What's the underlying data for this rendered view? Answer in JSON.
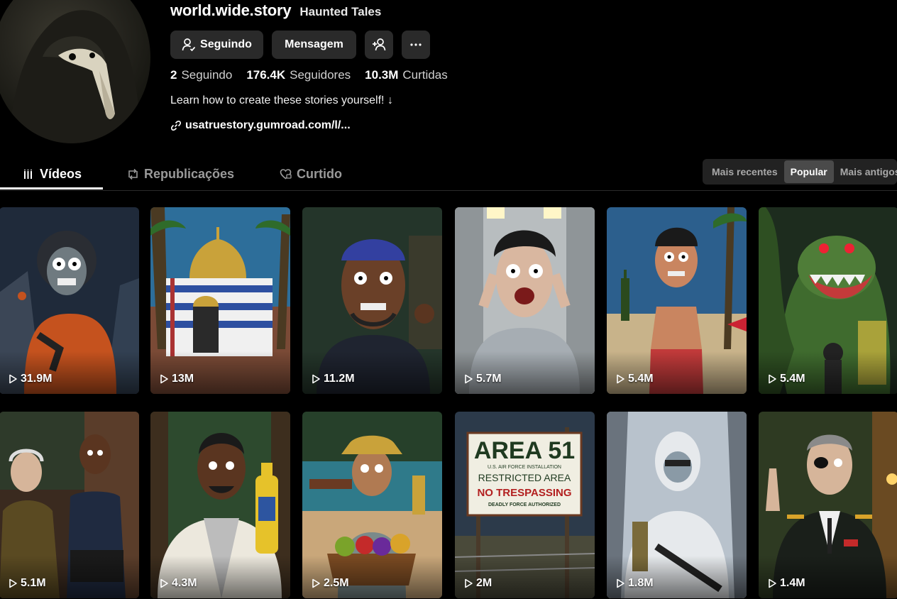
{
  "profile": {
    "username": "world.wide.story",
    "nickname": "Haunted Tales",
    "buttons": {
      "following": "Seguindo",
      "message": "Mensagem"
    },
    "stats": [
      {
        "value": "2",
        "label": "Seguindo"
      },
      {
        "value": "176.4K",
        "label": "Seguidores"
      },
      {
        "value": "10.3M",
        "label": "Curtidas"
      }
    ],
    "bio": "Learn how to create these stories yourself! ↓",
    "link": "usatruestory.gumroad.com/l/..."
  },
  "tabs": [
    {
      "label": "Vídeos",
      "icon": "grid-bars-icon"
    },
    {
      "label": "Republicações",
      "icon": "repost-icon"
    },
    {
      "label": "Curtido",
      "icon": "heart-icon"
    }
  ],
  "sort": {
    "options": [
      "Mais recentes",
      "Popular",
      "Mais antigos"
    ],
    "selected": "Popular"
  },
  "videos": [
    {
      "views": "31.9M",
      "theme": "astronaut"
    },
    {
      "views": "13M",
      "theme": "domed-shrine"
    },
    {
      "views": "11.2M",
      "theme": "bandana-man"
    },
    {
      "views": "5.7M",
      "theme": "screaming-man"
    },
    {
      "views": "5.4M",
      "theme": "beach-man"
    },
    {
      "views": "5.4M",
      "theme": "crocodile-monster"
    },
    {
      "views": "5.1M",
      "theme": "two-men"
    },
    {
      "views": "4.3M",
      "theme": "man-with-bottle"
    },
    {
      "views": "2.5M",
      "theme": "fruit-basket"
    },
    {
      "views": "2M",
      "theme": "area-51-sign"
    },
    {
      "views": "1.8M",
      "theme": "soldier-in-snow"
    },
    {
      "views": "1.4M",
      "theme": "general"
    }
  ],
  "sign": {
    "line1": "AREA 51",
    "line2": "U.S. AIR FORCE INSTALLATION",
    "line3": "RESTRICTED AREA",
    "line4": "NO TRESPASSING",
    "line5": "DEADLY FORCE AUTHORIZED"
  },
  "colors": {
    "background": "#000000",
    "button": "#2a2a2a",
    "muted": "#9a9a9a"
  }
}
